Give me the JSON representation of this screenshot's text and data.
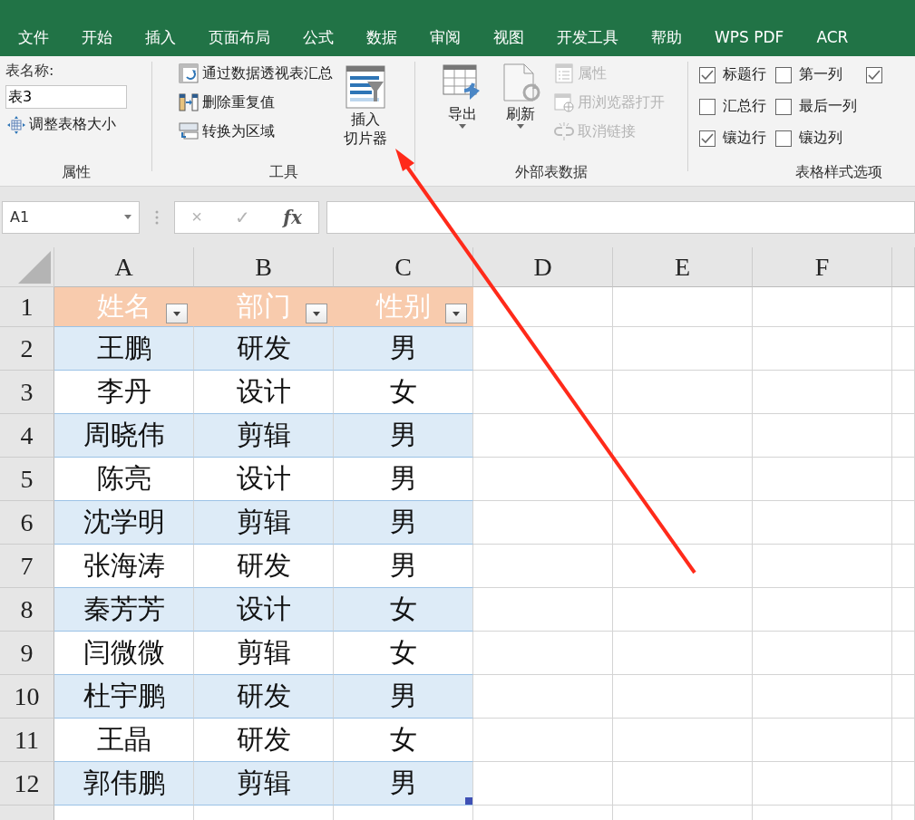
{
  "ribbon_tabs": [
    {
      "label": "文件",
      "selected": false
    },
    {
      "label": "开始",
      "selected": false
    },
    {
      "label": "插入",
      "selected": false
    },
    {
      "label": "页面布局",
      "selected": false
    },
    {
      "label": "公式",
      "selected": false
    },
    {
      "label": "数据",
      "selected": false
    },
    {
      "label": "审阅",
      "selected": false
    },
    {
      "label": "视图",
      "selected": false
    },
    {
      "label": "开发工具",
      "selected": false
    },
    {
      "label": "帮助",
      "selected": false
    },
    {
      "label": "WPS PDF",
      "selected": false
    },
    {
      "label": "ACR",
      "selected": false
    }
  ],
  "properties_group": {
    "title": "属性",
    "name_label": "表名称:",
    "name_value": "表3",
    "resize_button": "调整表格大小"
  },
  "tools_group": {
    "title": "工具",
    "items": [
      {
        "label": "通过数据透视表汇总",
        "kind": "pivot"
      },
      {
        "label": "删除重复值",
        "kind": "dedupe"
      },
      {
        "label": "转换为区域",
        "kind": "convert"
      }
    ],
    "slicer_button": [
      "插入",
      "切片器"
    ]
  },
  "external_group": {
    "title": "外部表数据",
    "big_buttons": [
      {
        "label": "导出",
        "kind": "export"
      },
      {
        "label": "刷新",
        "kind": "refresh"
      }
    ],
    "items": [
      {
        "label": "属性",
        "kind": "properties",
        "disabled": true
      },
      {
        "label": "用浏览器打开",
        "kind": "browser",
        "disabled": true
      },
      {
        "label": "取消链接",
        "kind": "unlink",
        "disabled": true
      }
    ]
  },
  "style_options_group": {
    "title": "表格样式选项",
    "options": [
      {
        "label": "标题行",
        "checked": true
      },
      {
        "label": "汇总行",
        "checked": false
      },
      {
        "label": "镶边行",
        "checked": true
      },
      {
        "label": "第一列",
        "checked": false
      },
      {
        "label": "最后一列",
        "checked": false
      },
      {
        "label": "镶边列",
        "checked": false
      },
      {
        "checked": true
      }
    ]
  },
  "formula_bar": {
    "name_box": "A1",
    "cancel": "×",
    "enter": "✓",
    "fx": "fx"
  },
  "sheet": {
    "columns": [
      "A",
      "B",
      "C",
      "D",
      "E",
      "F"
    ],
    "header": [
      "姓名",
      "部门",
      "性别"
    ],
    "rows": [
      {
        "number": "1"
      },
      {
        "number": "2",
        "cells": [
          "王鹏",
          "研发",
          "男"
        ]
      },
      {
        "number": "3",
        "cells": [
          "李丹",
          "设计",
          "女"
        ]
      },
      {
        "number": "4",
        "cells": [
          "周晓伟",
          "剪辑",
          "男"
        ]
      },
      {
        "number": "5",
        "cells": [
          "陈亮",
          "设计",
          "男"
        ]
      },
      {
        "number": "6",
        "cells": [
          "沈学明",
          "剪辑",
          "男"
        ]
      },
      {
        "number": "7",
        "cells": [
          "张海涛",
          "研发",
          "男"
        ]
      },
      {
        "number": "8",
        "cells": [
          "秦芳芳",
          "设计",
          "女"
        ]
      },
      {
        "number": "9",
        "cells": [
          "闫微微",
          "剪辑",
          "女"
        ]
      },
      {
        "number": "10",
        "cells": [
          "杜宇鹏",
          "研发",
          "男"
        ]
      },
      {
        "number": "11",
        "cells": [
          "王晶",
          "研发",
          "女"
        ]
      },
      {
        "number": "12",
        "cells": [
          "郭伟鹏",
          "剪辑",
          "男"
        ]
      }
    ]
  }
}
